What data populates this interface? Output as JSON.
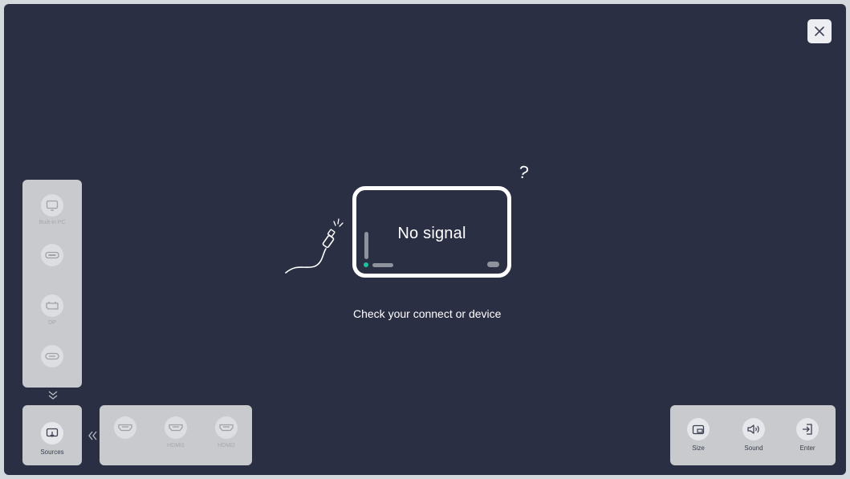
{
  "close_icon": "close-icon",
  "center": {
    "title": "No signal",
    "message": "Check your connect or device",
    "question_mark": "?"
  },
  "left_sources": [
    {
      "label": "Built-in PC",
      "icon": "monitor-icon"
    },
    {
      "label": "",
      "icon": "port-icon"
    },
    {
      "label": "DP",
      "icon": "displayport-icon"
    },
    {
      "label": "",
      "icon": "usb-c-icon"
    }
  ],
  "sources_button": {
    "label": "Sources",
    "icon": "cast-icon"
  },
  "hdmi_sources": [
    {
      "label": "",
      "icon": "hdmi-icon"
    },
    {
      "label": "HDMI1",
      "icon": "hdmi-icon"
    },
    {
      "label": "HDMI2",
      "icon": "hdmi-icon"
    }
  ],
  "right_actions": [
    {
      "label": "Size",
      "icon": "picture-in-picture-icon"
    },
    {
      "label": "Sound",
      "icon": "speaker-icon"
    },
    {
      "label": "Enter",
      "icon": "enter-icon"
    }
  ],
  "colors": {
    "background": "#2b2f44",
    "panel": "#c8cacd",
    "accent_dot": "#19c39a"
  }
}
